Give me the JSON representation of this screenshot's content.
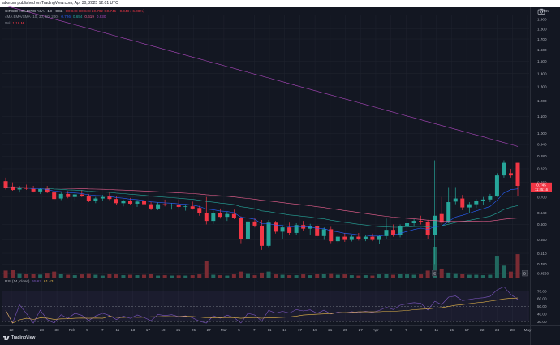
{
  "header": {
    "published": "aborum published on TradingView.com, Apr 30, 2025 12:01 UTC"
  },
  "legend": {
    "symbol": "CIRCIO HOLDING ASA · 1D · OSL",
    "ohlc": "O0.848 H0.848 L0.702 C0.745",
    "change": "-0.048 (-6.08%)",
    "ma_label": "4MA EMA/SMA (10, 30, 50, 200)",
    "ma_values": [
      "0.726",
      "0.654",
      "0.619",
      "0.930"
    ],
    "vol_label": "Vol",
    "vol_value": "1.18 M"
  },
  "currency": "NOK",
  "rsi_legend": {
    "label": "RSI (14, close)",
    "v1": "55.67",
    "v2": "61.43"
  },
  "branding": {
    "name": "TradingView"
  },
  "price_tags": {
    "last": "0.745",
    "countdown": "11:45:16"
  },
  "volume_marker": {
    "left": "E",
    "right": "D"
  },
  "colors": {
    "bg": "#131722",
    "grid": "#1e222d",
    "up": "#26a69a",
    "down": "#f23645",
    "upvol": "#21685f",
    "downvol": "#7a2b33",
    "ema10": "#2962ff",
    "ema30": "#26a69a",
    "sma50": "#f06292",
    "sma200": "#ab47bc",
    "rsi": "#7e57c2",
    "rsima": "#e8b84a"
  },
  "chart_data": {
    "type": "candlestick",
    "price_axis": {
      "ticks": [
        "1.900",
        "1.800",
        "1.700",
        "1.600",
        "1.500",
        "1.400",
        "1.300",
        "1.200",
        "1.100",
        "1.000",
        "0.940",
        "0.880",
        "0.820",
        "0.760",
        "0.700",
        "0.640",
        "0.600",
        "0.550",
        "0.510",
        "0.480",
        "0.4560"
      ],
      "scale": "log",
      "ylim": [
        0.445,
        1.95
      ]
    },
    "rsi_axis": {
      "ticks": [
        "70.00",
        "60.00",
        "50.00",
        "40.00",
        "30.00"
      ],
      "ylim": [
        28,
        76
      ]
    },
    "x_ticks": [
      "22",
      "24",
      "28",
      "30",
      "Feb",
      "5",
      "7",
      "11",
      "13",
      "17",
      "19",
      "21",
      "25",
      "27",
      "Mar",
      "5",
      "7",
      "11",
      "13",
      "17",
      "19",
      "21",
      "25",
      "27",
      "Apr",
      "3",
      "7",
      "9",
      "11",
      "15",
      "17",
      "22",
      "24",
      "28",
      "May"
    ],
    "candles": [
      {
        "o": 0.765,
        "h": 0.78,
        "l": 0.73,
        "c": 0.738,
        "v": 0.35
      },
      {
        "o": 0.742,
        "h": 0.76,
        "l": 0.725,
        "c": 0.728,
        "v": 0.4
      },
      {
        "o": 0.73,
        "h": 0.745,
        "l": 0.718,
        "c": 0.738,
        "v": 0.22
      },
      {
        "o": 0.738,
        "h": 0.75,
        "l": 0.728,
        "c": 0.733,
        "v": 0.18
      },
      {
        "o": 0.733,
        "h": 0.745,
        "l": 0.718,
        "c": 0.722,
        "v": 0.2
      },
      {
        "o": 0.722,
        "h": 0.738,
        "l": 0.712,
        "c": 0.732,
        "v": 0.15
      },
      {
        "o": 0.733,
        "h": 0.745,
        "l": 0.715,
        "c": 0.718,
        "v": 0.24
      },
      {
        "o": 0.718,
        "h": 0.728,
        "l": 0.688,
        "c": 0.692,
        "v": 0.3
      },
      {
        "o": 0.694,
        "h": 0.718,
        "l": 0.688,
        "c": 0.712,
        "v": 0.2
      },
      {
        "o": 0.712,
        "h": 0.724,
        "l": 0.695,
        "c": 0.7,
        "v": 0.14
      },
      {
        "o": 0.7,
        "h": 0.716,
        "l": 0.688,
        "c": 0.71,
        "v": 0.12
      },
      {
        "o": 0.71,
        "h": 0.728,
        "l": 0.7,
        "c": 0.704,
        "v": 0.16
      },
      {
        "o": 0.704,
        "h": 0.712,
        "l": 0.68,
        "c": 0.684,
        "v": 0.22
      },
      {
        "o": 0.686,
        "h": 0.7,
        "l": 0.676,
        "c": 0.694,
        "v": 0.14
      },
      {
        "o": 0.694,
        "h": 0.708,
        "l": 0.684,
        "c": 0.7,
        "v": 0.1
      },
      {
        "o": 0.702,
        "h": 0.72,
        "l": 0.688,
        "c": 0.692,
        "v": 0.18
      },
      {
        "o": 0.692,
        "h": 0.702,
        "l": 0.67,
        "c": 0.676,
        "v": 0.16
      },
      {
        "o": 0.676,
        "h": 0.69,
        "l": 0.664,
        "c": 0.684,
        "v": 0.12
      },
      {
        "o": 0.684,
        "h": 0.696,
        "l": 0.67,
        "c": 0.674,
        "v": 0.14
      },
      {
        "o": 0.674,
        "h": 0.688,
        "l": 0.662,
        "c": 0.682,
        "v": 0.12
      },
      {
        "o": 0.684,
        "h": 0.698,
        "l": 0.668,
        "c": 0.672,
        "v": 0.14
      },
      {
        "o": 0.672,
        "h": 0.682,
        "l": 0.65,
        "c": 0.656,
        "v": 0.18
      },
      {
        "o": 0.656,
        "h": 0.678,
        "l": 0.65,
        "c": 0.672,
        "v": 0.1
      },
      {
        "o": 0.672,
        "h": 0.69,
        "l": 0.664,
        "c": 0.668,
        "v": 0.12
      },
      {
        "o": 0.668,
        "h": 0.676,
        "l": 0.652,
        "c": 0.67,
        "v": 0.1
      },
      {
        "o": 0.67,
        "h": 0.69,
        "l": 0.658,
        "c": 0.662,
        "v": 0.11
      },
      {
        "o": 0.662,
        "h": 0.672,
        "l": 0.648,
        "c": 0.664,
        "v": 0.1
      },
      {
        "o": 0.664,
        "h": 0.682,
        "l": 0.652,
        "c": 0.656,
        "v": 0.12
      },
      {
        "o": 0.658,
        "h": 0.666,
        "l": 0.63,
        "c": 0.64,
        "v": 0.16
      },
      {
        "o": 0.64,
        "h": 0.7,
        "l": 0.6,
        "c": 0.612,
        "v": 0.85
      },
      {
        "o": 0.612,
        "h": 0.648,
        "l": 0.602,
        "c": 0.64,
        "v": 0.14
      },
      {
        "o": 0.64,
        "h": 0.656,
        "l": 0.62,
        "c": 0.626,
        "v": 0.12
      },
      {
        "o": 0.626,
        "h": 0.644,
        "l": 0.612,
        "c": 0.636,
        "v": 0.1
      },
      {
        "o": 0.636,
        "h": 0.652,
        "l": 0.618,
        "c": 0.622,
        "v": 0.16
      },
      {
        "o": 0.622,
        "h": 0.628,
        "l": 0.54,
        "c": 0.552,
        "v": 0.3
      },
      {
        "o": 0.552,
        "h": 0.618,
        "l": 0.545,
        "c": 0.61,
        "v": 0.22
      },
      {
        "o": 0.61,
        "h": 0.622,
        "l": 0.59,
        "c": 0.596,
        "v": 0.12
      },
      {
        "o": 0.596,
        "h": 0.615,
        "l": 0.52,
        "c": 0.532,
        "v": 0.25
      },
      {
        "o": 0.532,
        "h": 0.615,
        "l": 0.528,
        "c": 0.606,
        "v": 0.3
      },
      {
        "o": 0.606,
        "h": 0.612,
        "l": 0.57,
        "c": 0.576,
        "v": 0.16
      },
      {
        "o": 0.576,
        "h": 0.598,
        "l": 0.552,
        "c": 0.59,
        "v": 0.14
      },
      {
        "o": 0.59,
        "h": 0.606,
        "l": 0.566,
        "c": 0.572,
        "v": 0.12
      },
      {
        "o": 0.572,
        "h": 0.604,
        "l": 0.565,
        "c": 0.598,
        "v": 0.12
      },
      {
        "o": 0.598,
        "h": 0.612,
        "l": 0.58,
        "c": 0.586,
        "v": 0.16
      },
      {
        "o": 0.586,
        "h": 0.602,
        "l": 0.566,
        "c": 0.594,
        "v": 0.12
      },
      {
        "o": 0.594,
        "h": 0.6,
        "l": 0.558,
        "c": 0.562,
        "v": 0.18
      },
      {
        "o": 0.562,
        "h": 0.59,
        "l": 0.55,
        "c": 0.584,
        "v": 0.2
      },
      {
        "o": 0.584,
        "h": 0.592,
        "l": 0.54,
        "c": 0.546,
        "v": 0.22
      },
      {
        "o": 0.546,
        "h": 0.566,
        "l": 0.54,
        "c": 0.56,
        "v": 0.14
      },
      {
        "o": 0.56,
        "h": 0.572,
        "l": 0.544,
        "c": 0.55,
        "v": 0.16
      },
      {
        "o": 0.55,
        "h": 0.566,
        "l": 0.545,
        "c": 0.56,
        "v": 0.12
      },
      {
        "o": 0.56,
        "h": 0.572,
        "l": 0.548,
        "c": 0.552,
        "v": 0.1
      },
      {
        "o": 0.552,
        "h": 0.566,
        "l": 0.546,
        "c": 0.56,
        "v": 0.12
      },
      {
        "o": 0.56,
        "h": 0.57,
        "l": 0.546,
        "c": 0.55,
        "v": 0.1
      },
      {
        "o": 0.55,
        "h": 0.566,
        "l": 0.538,
        "c": 0.562,
        "v": 0.16
      },
      {
        "o": 0.562,
        "h": 0.62,
        "l": 0.552,
        "c": 0.582,
        "v": 0.2
      },
      {
        "o": 0.582,
        "h": 0.6,
        "l": 0.56,
        "c": 0.566,
        "v": 0.14
      },
      {
        "o": 0.566,
        "h": 0.6,
        "l": 0.558,
        "c": 0.594,
        "v": 0.18
      },
      {
        "o": 0.594,
        "h": 0.612,
        "l": 0.582,
        "c": 0.604,
        "v": 0.16
      },
      {
        "o": 0.604,
        "h": 0.618,
        "l": 0.592,
        "c": 0.612,
        "v": 0.14
      },
      {
        "o": 0.612,
        "h": 0.63,
        "l": 0.6,
        "c": 0.608,
        "v": 0.16
      },
      {
        "o": 0.608,
        "h": 0.616,
        "l": 0.554,
        "c": 0.566,
        "v": 0.35
      },
      {
        "o": 0.566,
        "h": 0.86,
        "l": 0.48,
        "c": 0.63,
        "v": 1.55
      },
      {
        "o": 0.636,
        "h": 0.7,
        "l": 0.6,
        "c": 0.606,
        "v": 0.45
      },
      {
        "o": 0.606,
        "h": 0.74,
        "l": 0.604,
        "c": 0.68,
        "v": 0.25
      },
      {
        "o": 0.682,
        "h": 0.74,
        "l": 0.672,
        "c": 0.694,
        "v": 0.22
      },
      {
        "o": 0.694,
        "h": 0.708,
        "l": 0.65,
        "c": 0.66,
        "v": 0.2
      },
      {
        "o": 0.66,
        "h": 0.68,
        "l": 0.64,
        "c": 0.672,
        "v": 0.14
      },
      {
        "o": 0.672,
        "h": 0.692,
        "l": 0.658,
        "c": 0.684,
        "v": 0.14
      },
      {
        "o": 0.684,
        "h": 0.7,
        "l": 0.668,
        "c": 0.69,
        "v": 0.12
      },
      {
        "o": 0.69,
        "h": 0.712,
        "l": 0.68,
        "c": 0.704,
        "v": 0.14
      },
      {
        "o": 0.704,
        "h": 0.8,
        "l": 0.7,
        "c": 0.79,
        "v": 1.1
      },
      {
        "o": 0.79,
        "h": 0.86,
        "l": 0.78,
        "c": 0.848,
        "v": 0.6
      },
      {
        "o": 0.8,
        "h": 0.82,
        "l": 0.78,
        "c": 0.79,
        "v": 0.3
      },
      {
        "o": 0.848,
        "h": 0.848,
        "l": 0.702,
        "c": 0.745,
        "v": 1.18
      }
    ],
    "volume_unit": "M"
  }
}
